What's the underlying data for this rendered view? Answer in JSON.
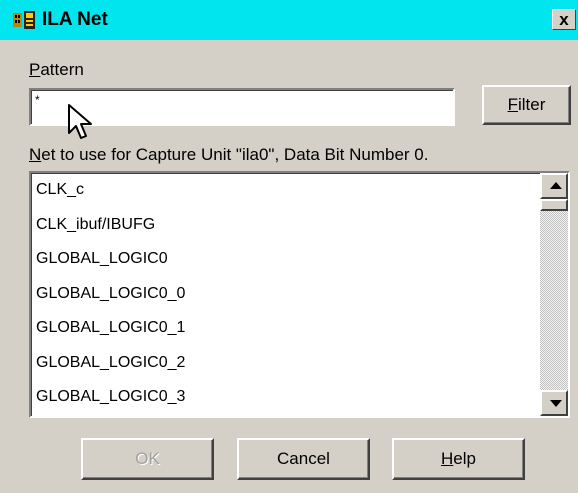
{
  "window": {
    "title": "ILA Net",
    "close_label": "x",
    "icon": "app-icon"
  },
  "pattern": {
    "label_first": "P",
    "label_rest": "attern",
    "value": "*"
  },
  "filter_button": {
    "first": "F",
    "rest": "ilter"
  },
  "net_label": {
    "first": "N",
    "rest": "et to use for Capture Unit \"ila0\", Data Bit Number 0."
  },
  "net_list": {
    "items": [
      "CLK_c",
      "CLK_ibuf/IBUFG",
      "GLOBAL_LOGIC0",
      "GLOBAL_LOGIC0_0",
      "GLOBAL_LOGIC0_1",
      "GLOBAL_LOGIC0_2",
      "GLOBAL_LOGIC0_3"
    ]
  },
  "buttons": {
    "ok": "OK",
    "cancel": "Cancel",
    "help_first": "H",
    "help_rest": "elp"
  },
  "colors": {
    "titlebar": "#00e5ee",
    "dialog_face": "#d4d0c8"
  }
}
